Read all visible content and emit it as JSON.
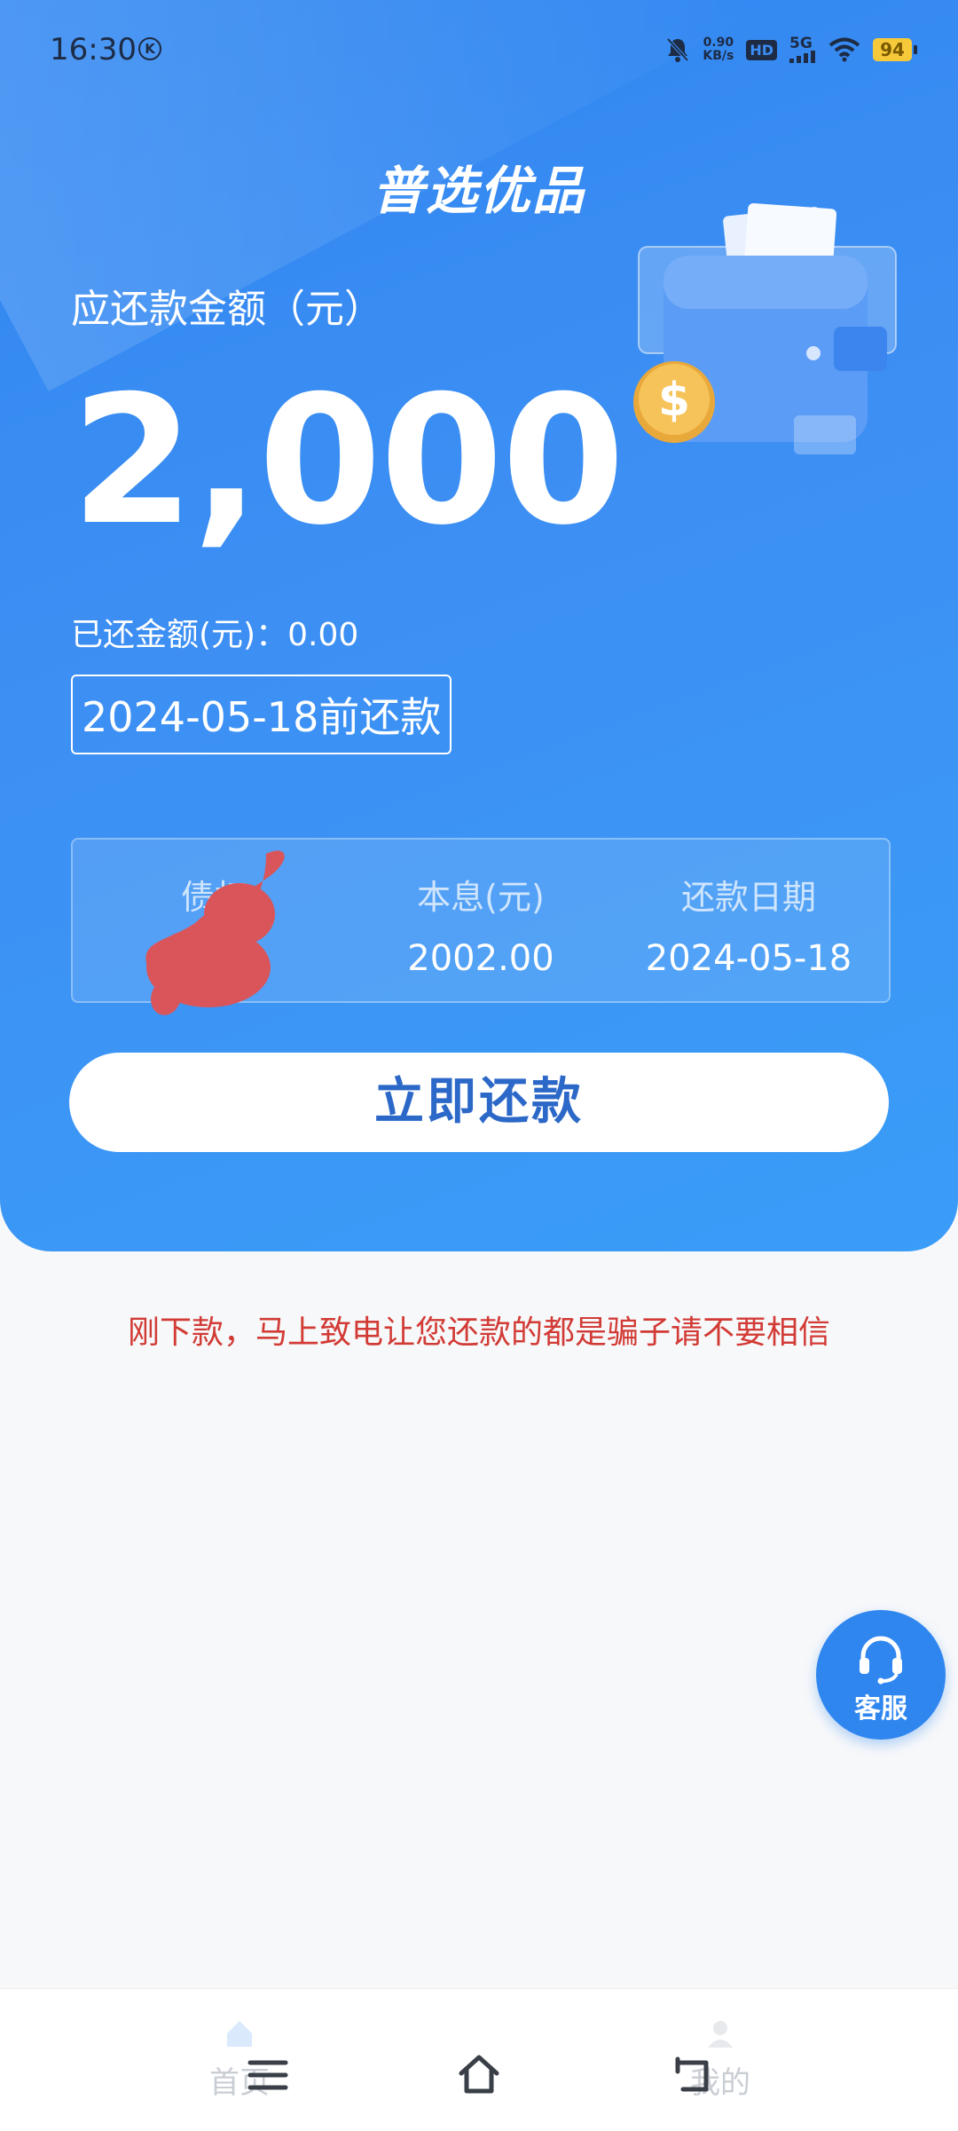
{
  "status_bar": {
    "time": "16:30",
    "net_speed_value": "0.90",
    "net_speed_unit": "KB/s",
    "hd_badge": "HD",
    "network": "5G",
    "battery": "94"
  },
  "app_title": "普选优品",
  "repayment": {
    "due_label": "应还款金额（元）",
    "due_amount": "2,000",
    "paid_label": "已还金额(元)：0.00",
    "deadline": "2024-05-18前还款"
  },
  "info_card": {
    "columns": [
      {
        "header": "债权",
        "value": ""
      },
      {
        "header": "本息(元)",
        "value": "2002.00"
      },
      {
        "header": "还款日期",
        "value": "2024-05-18"
      }
    ]
  },
  "pay_button": "立即还款",
  "warning_text": "刚下款，马上致电让您还款的都是骗子请不要相信",
  "customer_service": "客服",
  "tabs": [
    {
      "label": "首页",
      "icon": "home-icon",
      "active": true
    },
    {
      "label": "我的",
      "icon": "user-icon",
      "active": false
    }
  ],
  "colors": {
    "primary": "#2f86f1",
    "warning": "#d23b35",
    "button_text": "#2c68c8"
  }
}
